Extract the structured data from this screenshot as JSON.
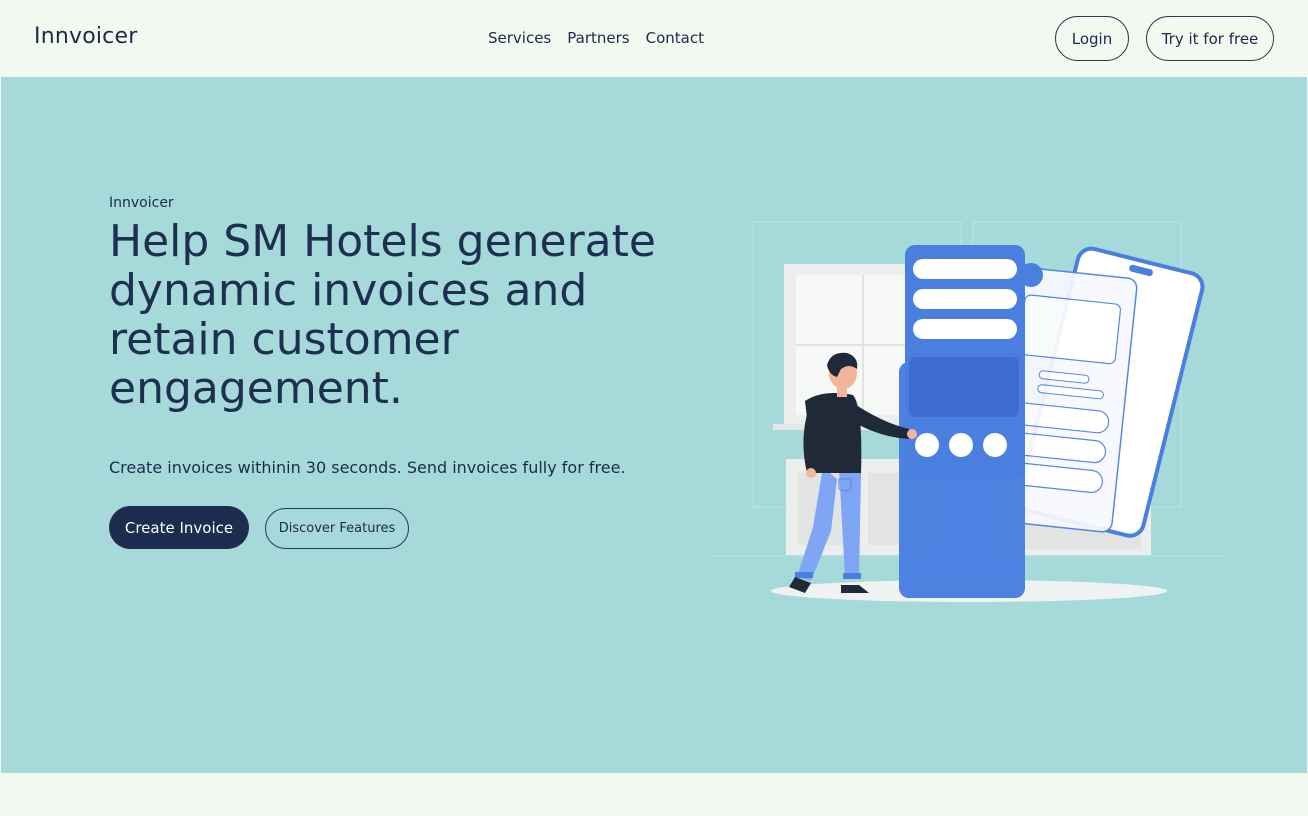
{
  "nav": {
    "brand": "Innvoicer",
    "links": [
      "Services",
      "Partners",
      "Contact"
    ],
    "login_label": "Login",
    "try_label": "Try it for free"
  },
  "hero": {
    "eyebrow": "Innvoicer",
    "headline": "Help SM Hotels generate dynamic invoices and retain customer engagement.",
    "subtext": "Create invoices withinin 30 seconds. Send invoices fully for free.",
    "primary_cta": "Create Invoice",
    "secondary_cta": "Discover Features",
    "illustration": "person-with-invoice-phone-illustration"
  },
  "colors": {
    "nav_bg": "#f1f9f0",
    "hero_bg": "#a6d9d9",
    "primary": "#1d2d50",
    "accent_blue": "#4a7fe0"
  }
}
